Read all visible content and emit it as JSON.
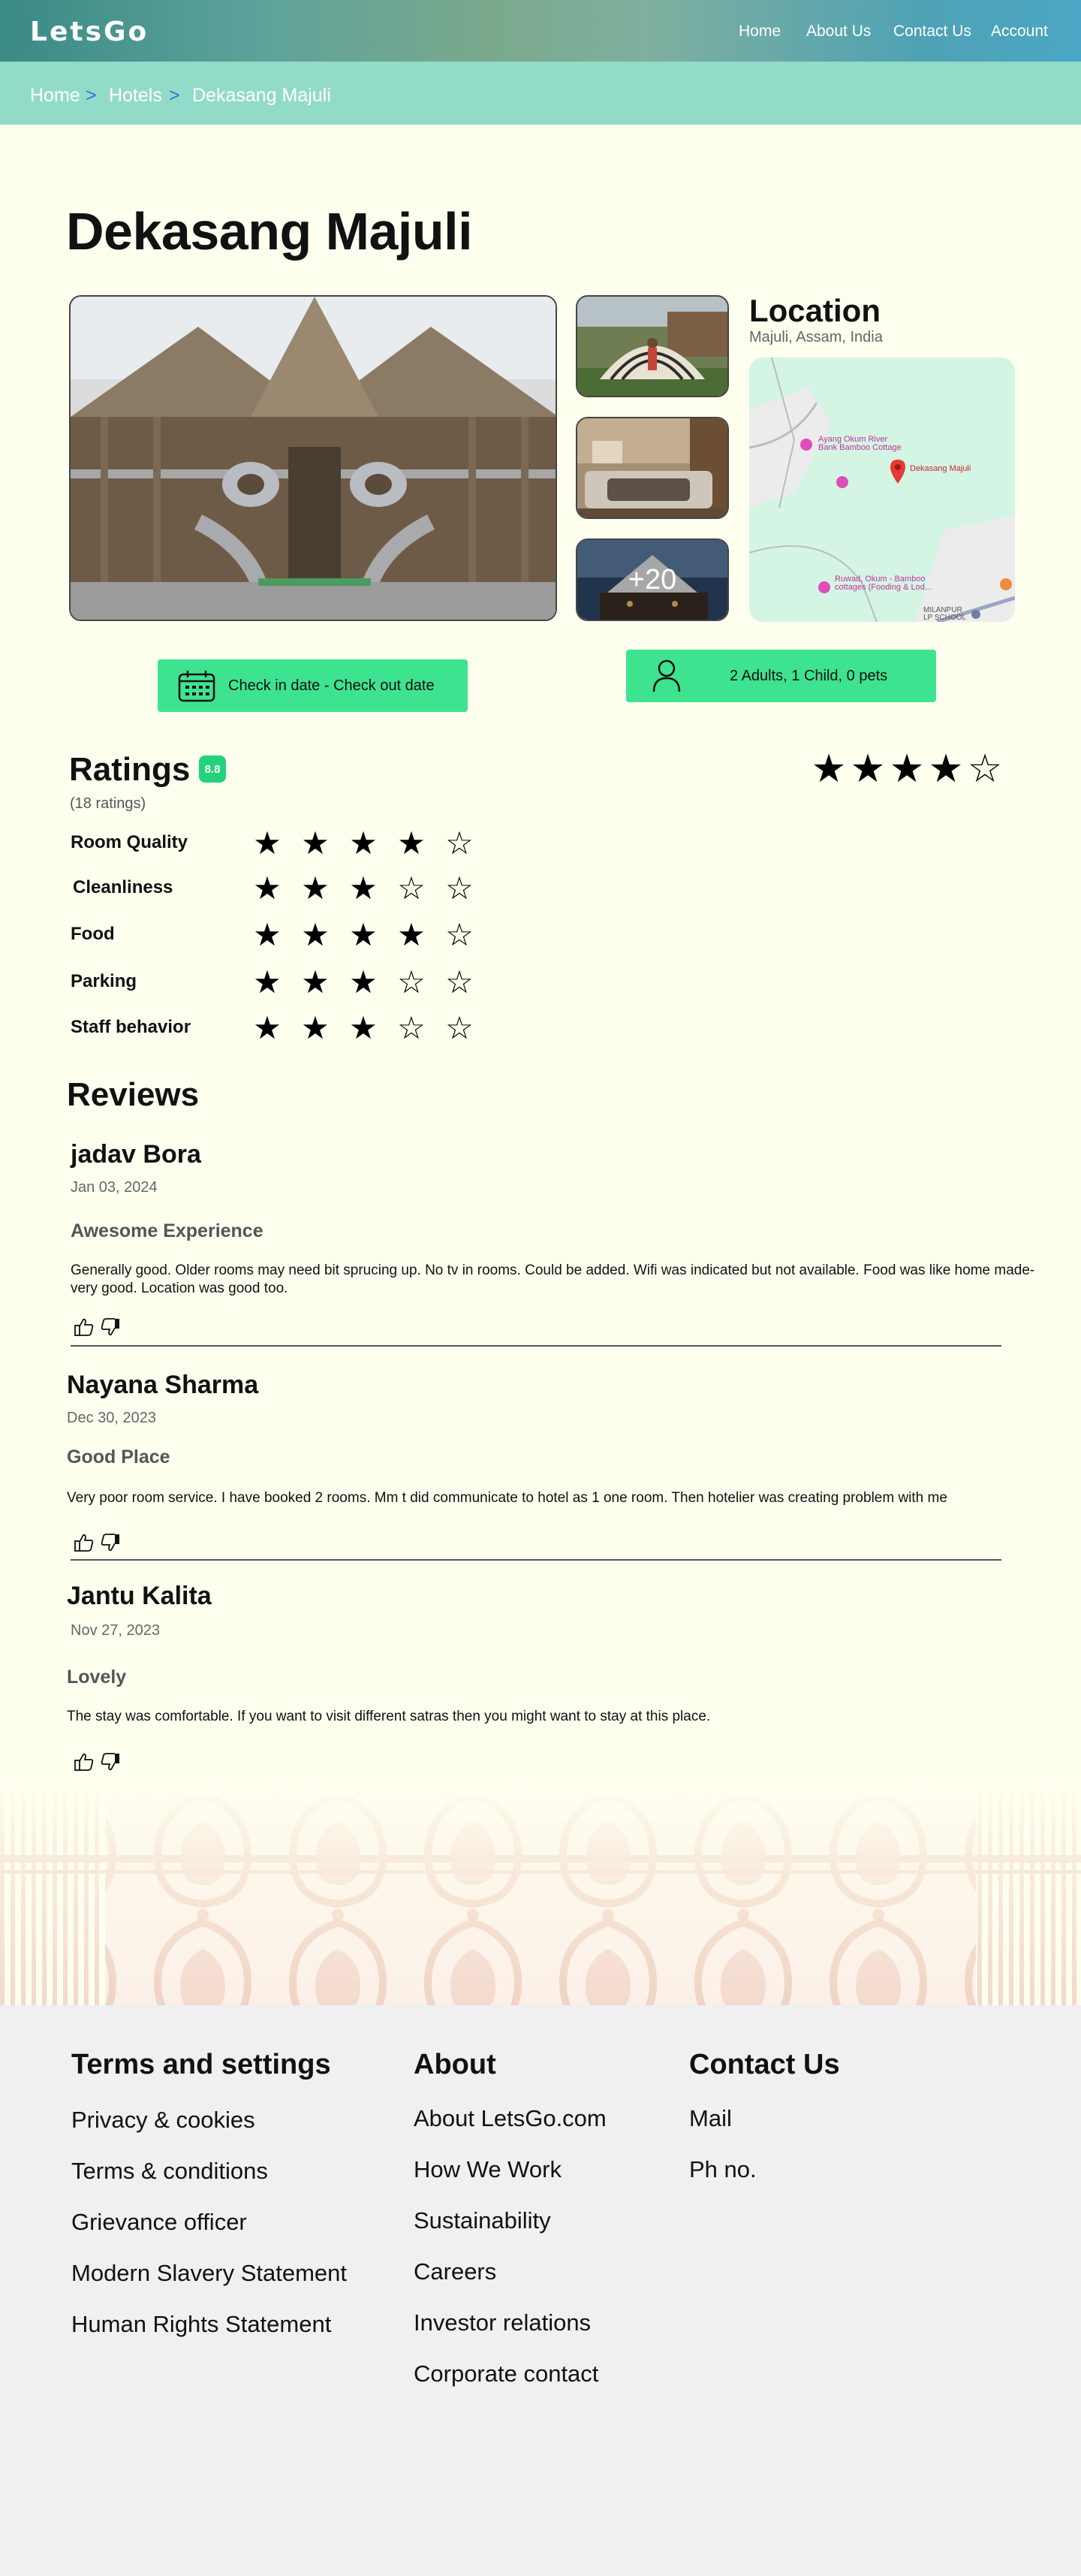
{
  "header": {
    "logo": "LetsGo",
    "nav": [
      "Home",
      "About Us",
      "Contact Us",
      "Account"
    ]
  },
  "breadcrumb": {
    "items": [
      "Home",
      "Hotels",
      "Dekasang Majuli"
    ],
    "separator": ">"
  },
  "hotel": {
    "name": "Dekasang Majuli",
    "more_photos": "+20"
  },
  "location": {
    "title": "Location",
    "address": "Majuli, Assam, India",
    "map_labels": {
      "place1": "Ayang Okum River\nBank Bamboo Cottage",
      "hotel": "Dekasang Majuli",
      "place2": "Ruwad, Okum - Bamboo\ncottages (Fooding & Lod...",
      "place3": "MILANPUR\nLP SCHOOL"
    }
  },
  "booking": {
    "dates_label": "Check in date - Check out date",
    "guests_label": "2 Adults, 1 Child, 0 pets"
  },
  "ratings": {
    "title": "Ratings",
    "score": "8.8",
    "count": "(18 ratings)",
    "overall_stars": 4,
    "max_stars": 5,
    "categories": [
      {
        "label": "Room Quality",
        "stars": 4
      },
      {
        "label": "Cleanliness",
        "stars": 3
      },
      {
        "label": "Food",
        "stars": 4
      },
      {
        "label": "Parking",
        "stars": 3
      },
      {
        "label": "Staff behavior",
        "stars": 3
      }
    ]
  },
  "reviews": {
    "title": "Reviews",
    "items": [
      {
        "name": "jadav Bora",
        "date": "Jan 03, 2024",
        "title": "Awesome Experience",
        "body": "Generally good. Older rooms may need bit sprucing up. No tv in rooms. Could be added. Wifi was indicated but not available. Food was like home made- very good. Location was good too."
      },
      {
        "name": "Nayana Sharma",
        "date": "Dec 30, 2023",
        "title": "Good Place",
        "body": "Very poor room service. I have booked 2 rooms. Mm t did communicate to hotel as 1 one room. Then hotelier was creating problem with me"
      },
      {
        "name": "Jantu Kalita",
        "date": "Nov 27, 2023",
        "title": "Lovely",
        "body": "The stay was comfortable. If you want to visit different satras then you might want to stay at this place."
      }
    ]
  },
  "footer": {
    "terms": {
      "title": "Terms and settings",
      "links": [
        "Privacy & cookies",
        "Terms & conditions",
        "Grievance officer",
        "Modern Slavery Statement",
        "Human Rights Statement"
      ]
    },
    "about": {
      "title": "About",
      "links": [
        "About LetsGo.com",
        "How We Work",
        "Sustainability",
        "Careers",
        "Investor relations",
        "Corporate contact"
      ]
    },
    "contact": {
      "title": "Contact Us",
      "links": [
        "Mail",
        "Ph no."
      ]
    }
  },
  "colors": {
    "accent_green": "#3ee38f",
    "breadcrumb_bg": "#93dbc9",
    "page_bg": "#fffff0",
    "footer_bg": "#f0f0f0"
  },
  "icons": [
    "calendar-icon",
    "person-icon",
    "thumbs-up-icon",
    "thumbs-down-icon",
    "star-icon",
    "map-pin-icon"
  ]
}
